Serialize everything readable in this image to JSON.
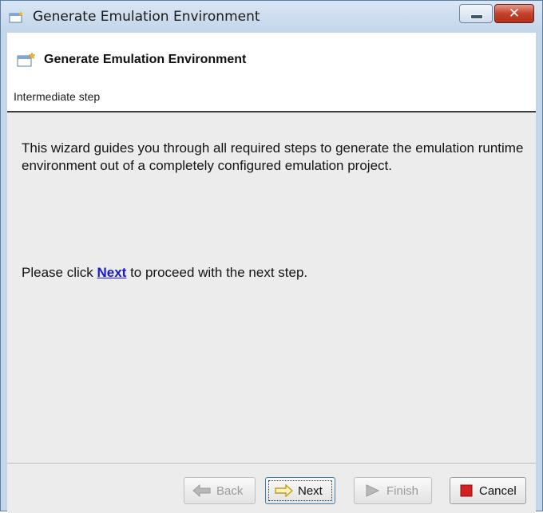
{
  "window": {
    "title": "Generate Emulation Environment",
    "controls": {
      "minimize_icon": "minimize-icon",
      "close_icon": "close-icon"
    }
  },
  "header": {
    "title": "Generate Emulation Environment",
    "subtitle": "Intermediate step",
    "icon": "wizard-icon"
  },
  "body": {
    "description": "This wizard guides you through all required steps to generate the emulation runtime environment out of a completely configured emulation project.",
    "instruction_prefix": "Please click ",
    "instruction_link": "Next",
    "instruction_suffix": " to proceed with the next step."
  },
  "buttons": {
    "back": {
      "label": "Back",
      "icon": "arrow-left-icon",
      "enabled": false
    },
    "next": {
      "label": "Next",
      "icon": "arrow-right-icon",
      "enabled": true
    },
    "finish": {
      "label": "Finish",
      "icon": "play-icon",
      "enabled": false
    },
    "cancel": {
      "label": "Cancel",
      "icon": "stop-icon",
      "enabled": true
    }
  },
  "colors": {
    "link": "#1a1ac8",
    "cancel_icon": "#d42020",
    "next_icon": "#f5c518",
    "title_bar": "#c4d6ea",
    "close_button": "#c4412b"
  }
}
